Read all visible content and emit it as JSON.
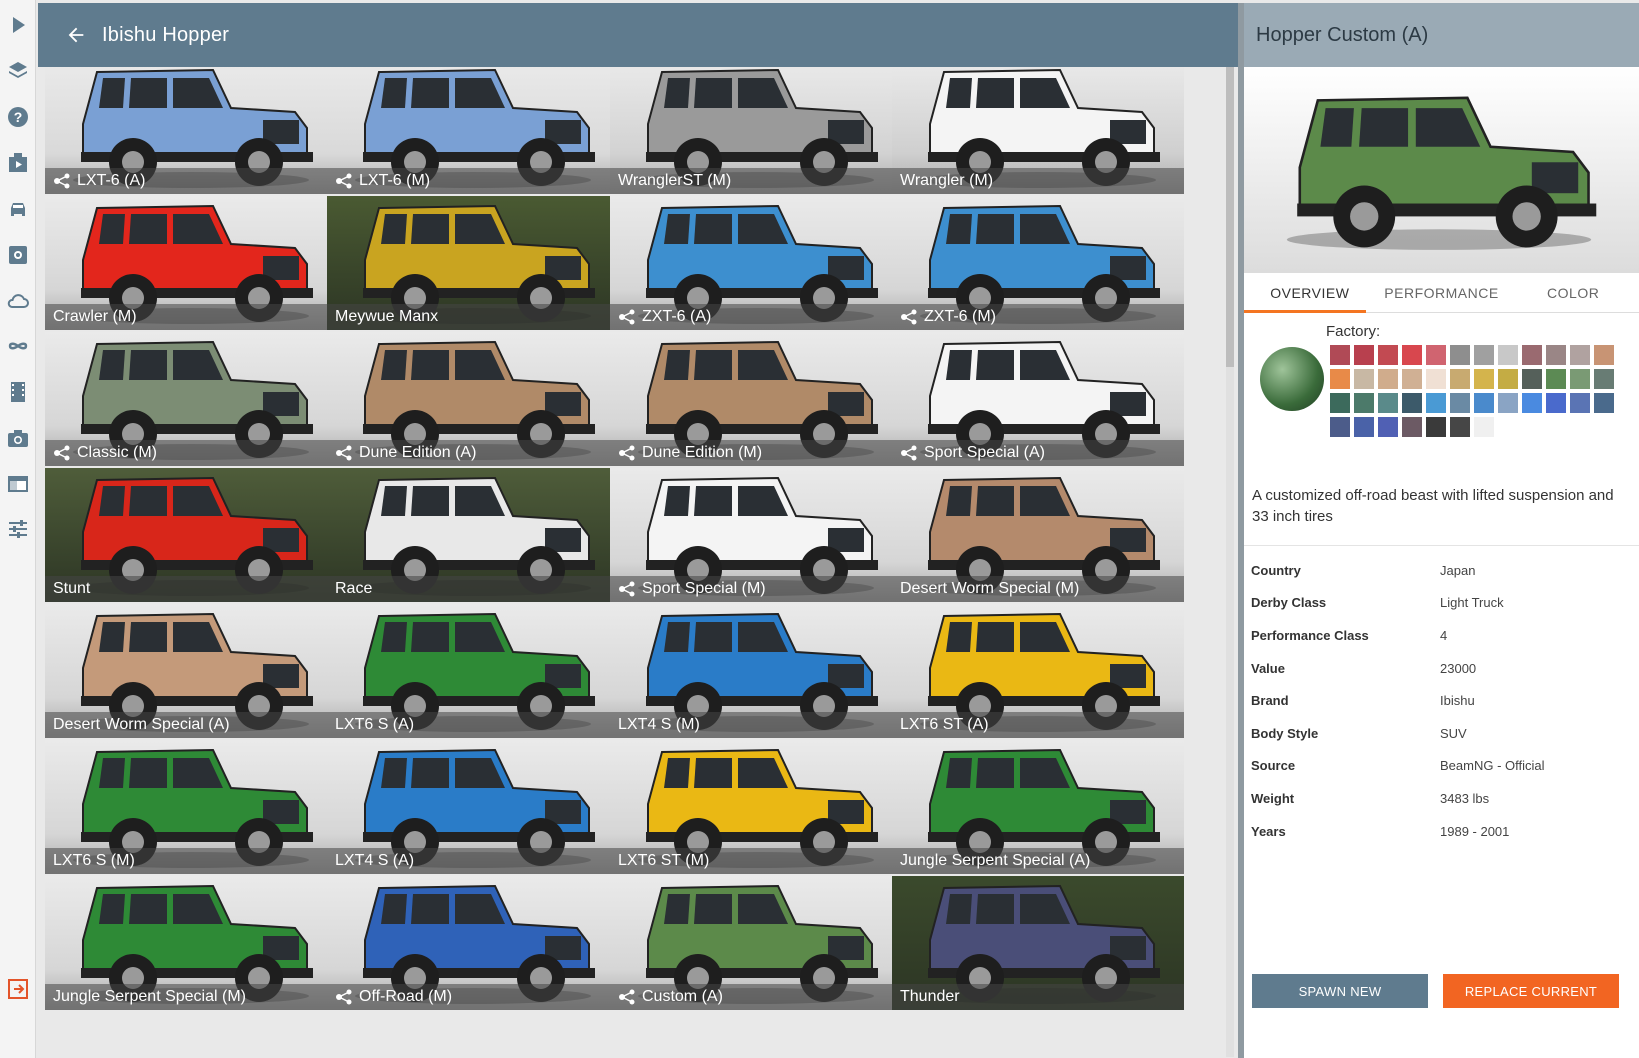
{
  "header": {
    "title": "Ibishu Hopper"
  },
  "rail": [
    {
      "icon": "play-icon"
    },
    {
      "icon": "layers-icon"
    },
    {
      "icon": "help-icon"
    },
    {
      "icon": "scenario-icon"
    },
    {
      "icon": "car-icon"
    },
    {
      "icon": "parts-icon"
    },
    {
      "icon": "cloud-icon"
    },
    {
      "icon": "infinity-icon"
    },
    {
      "icon": "film-icon"
    },
    {
      "icon": "camera-icon"
    },
    {
      "icon": "layout-icon"
    },
    {
      "icon": "sliders-icon"
    },
    {
      "icon": "exit-icon"
    }
  ],
  "grid": {
    "tiles": [
      {
        "label": "LXT-6 (A)",
        "linked": true,
        "body": "#7aa0d4",
        "bg": "#d9d9d9"
      },
      {
        "label": "LXT-6 (M)",
        "linked": true,
        "body": "#7aa0d4",
        "bg": "#d9d9d9"
      },
      {
        "label": "WranglerST (M)",
        "linked": false,
        "body": "#9a9a9a",
        "bg": "#d2d2d2"
      },
      {
        "label": "Wrangler (M)",
        "linked": false,
        "body": "#f4f4f4",
        "bg": "#cfcfcf"
      },
      {
        "label": "Crawler (M)",
        "linked": false,
        "body": "#e3261c",
        "bg": "#d6d6d6"
      },
      {
        "label": "Meywue Manx",
        "linked": false,
        "body": "#c9a420",
        "bg": "#4a5a32"
      },
      {
        "label": "ZXT-6 (A)",
        "linked": true,
        "body": "#3d8fcf",
        "bg": "#d6d6d6"
      },
      {
        "label": "ZXT-6 (M)",
        "linked": true,
        "body": "#3d8fcf",
        "bg": "#d6d6d6"
      },
      {
        "label": "Classic (M)",
        "linked": true,
        "body": "#7c8d74",
        "bg": "#d6d6d6"
      },
      {
        "label": "Dune Edition (A)",
        "linked": true,
        "body": "#b08a68",
        "bg": "#d6d6d6"
      },
      {
        "label": "Dune Edition (M)",
        "linked": true,
        "body": "#b08a68",
        "bg": "#d6d6d6"
      },
      {
        "label": "Sport Special (A)",
        "linked": true,
        "body": "#f4f4f4",
        "bg": "#d6d6d6"
      },
      {
        "label": "Stunt",
        "linked": false,
        "body": "#d8261a",
        "bg": "#4f5d3a"
      },
      {
        "label": "Race",
        "linked": false,
        "body": "#e8e8e8",
        "bg": "#4f5d3a"
      },
      {
        "label": "Sport Special (M)",
        "linked": true,
        "body": "#f4f4f4",
        "bg": "#d6d6d6"
      },
      {
        "label": "Desert Worm Special (M)",
        "linked": false,
        "body": "#b48a6c",
        "bg": "#d6d6d6"
      },
      {
        "label": "Desert Worm Special (A)",
        "linked": false,
        "body": "#c49a7a",
        "bg": "#d6d6d6"
      },
      {
        "label": "LXT6 S (A)",
        "linked": false,
        "body": "#2e8a36",
        "bg": "#d6d6d6"
      },
      {
        "label": "LXT4 S (M)",
        "linked": false,
        "body": "#2a7cc8",
        "bg": "#d6d6d6"
      },
      {
        "label": "LXT6 ST (A)",
        "linked": false,
        "body": "#eab814",
        "bg": "#d6d6d6"
      },
      {
        "label": "LXT6 S (M)",
        "linked": false,
        "body": "#2e8a36",
        "bg": "#d6d6d6"
      },
      {
        "label": "LXT4 S (A)",
        "linked": false,
        "body": "#2a7cc8",
        "bg": "#d6d6d6"
      },
      {
        "label": "LXT6 ST (M)",
        "linked": false,
        "body": "#eab814",
        "bg": "#d6d6d6"
      },
      {
        "label": "Jungle Serpent Special (A)",
        "linked": false,
        "body": "#2e8a36",
        "bg": "#d6d6d6"
      },
      {
        "label": "Jungle Serpent Special (M)",
        "linked": false,
        "body": "#2e8a36",
        "bg": "#d6d6d6"
      },
      {
        "label": "Off-Road (M)",
        "linked": true,
        "body": "#2f62b8",
        "bg": "#d6d6d6"
      },
      {
        "label": "Custom (A)",
        "linked": true,
        "body": "#5c8a4a",
        "bg": "#d6d6d6"
      },
      {
        "label": "Thunder",
        "linked": false,
        "body": "#4a4e78",
        "bg": "#3b4a2c"
      }
    ]
  },
  "panel": {
    "title": "Hopper Custom (A)",
    "preview_body": "#5c8a4a",
    "tabs": [
      "OVERVIEW",
      "PERFORMANCE",
      "COLOR"
    ],
    "factory_label": "Factory:",
    "orb_color": "#3a6b3a",
    "swatches": [
      "#b04a56",
      "#b8404e",
      "#c24a52",
      "#d8474e",
      "#d06470",
      "#8e8e8e",
      "#a0a0a0",
      "#c8c8c8",
      "#9a6a70",
      "#9a8686",
      "#b0a2a0",
      "#c89474",
      "#e88a48",
      "#c8b8a4",
      "#d0ac8c",
      "#d0b094",
      "#f0e0d4",
      "#c8aa70",
      "#d4b44c",
      "#c4ac44",
      "#55605a",
      "#5c8a54",
      "#7a9a74",
      "#687c74",
      "#3c6a5c",
      "#4c7a6a",
      "#5a8a8a",
      "#3c5a6a",
      "#4a9ad4",
      "#6a8aa4",
      "#4a8acc",
      "#8aa4c4",
      "#4a8ae0",
      "#4a6acc",
      "#5a74b4",
      "#4a6a8c",
      "#4c5c8a",
      "#4a62a8",
      "#5060b4",
      "#6c5a64",
      "#3a3a3a",
      "#464646",
      "#f0f0f0"
    ],
    "description": "A customized off-road beast with lifted suspension and 33 inch tires",
    "info": [
      {
        "k": "Country",
        "v": "Japan"
      },
      {
        "k": "Derby Class",
        "v": "Light Truck"
      },
      {
        "k": "Performance Class",
        "v": "4"
      },
      {
        "k": "Value",
        "v": "23000"
      },
      {
        "k": "Brand",
        "v": "Ibishu"
      },
      {
        "k": "Body Style",
        "v": "SUV"
      },
      {
        "k": "Source",
        "v": "BeamNG - Official"
      },
      {
        "k": "Weight",
        "v": "3483 lbs"
      },
      {
        "k": "Years",
        "v": "1989 - 2001"
      }
    ],
    "spawn_new": "SPAWN NEW",
    "replace_current": "REPLACE CURRENT"
  }
}
